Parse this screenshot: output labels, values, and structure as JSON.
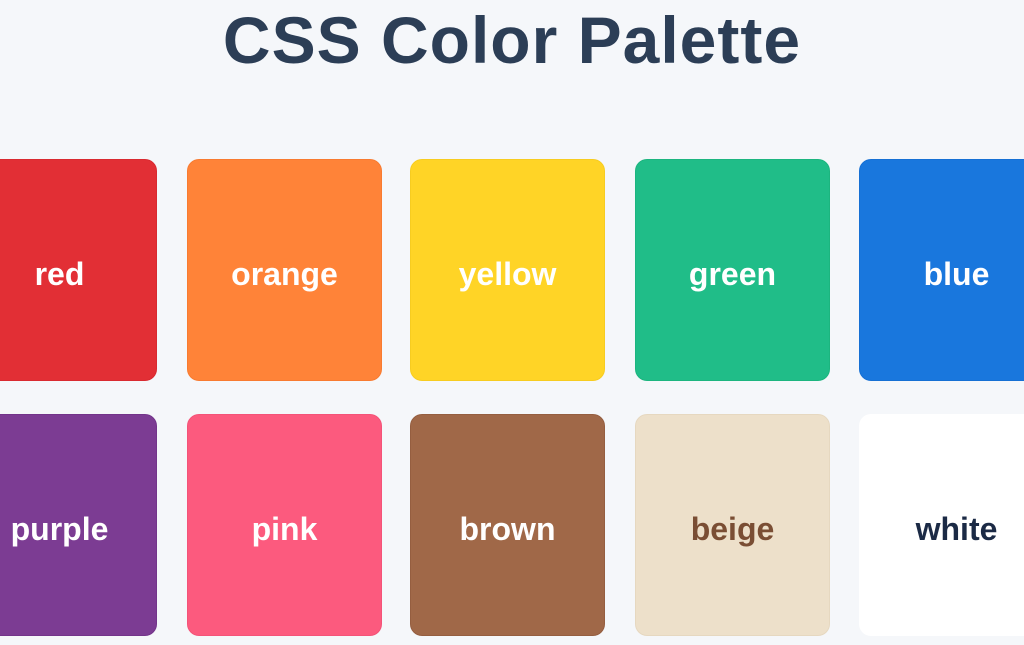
{
  "title": "CSS Color Palette",
  "colors": [
    {
      "name": "red",
      "bg": "#e22f35",
      "text": "#ffffff",
      "border": "#d92a30"
    },
    {
      "name": "orange",
      "bg": "#ff8338",
      "text": "#ffffff",
      "border": "#f87b30"
    },
    {
      "name": "yellow",
      "bg": "#ffd426",
      "text": "#ffffff",
      "border": "#f7cc20"
    },
    {
      "name": "green",
      "bg": "#20bd88",
      "text": "#ffffff",
      "border": "#1cb57f"
    },
    {
      "name": "blue",
      "bg": "#1977dd",
      "text": "#ffffff",
      "border": "#1670d4"
    },
    {
      "name": "purple",
      "bg": "#7c3c93",
      "text": "#ffffff",
      "border": "#73348a"
    },
    {
      "name": "pink",
      "bg": "#fc5a7e",
      "text": "#ffffff",
      "border": "#f45378"
    },
    {
      "name": "brown",
      "bg": "#a06848",
      "text": "#ffffff",
      "border": "#955e40"
    },
    {
      "name": "beige",
      "bg": "#ede0ca",
      "text": "#7a4e34",
      "border": "#e6d8c0"
    },
    {
      "name": "white",
      "bg": "#ffffff",
      "text": "#1b2a45",
      "border": "#ffffff"
    }
  ]
}
